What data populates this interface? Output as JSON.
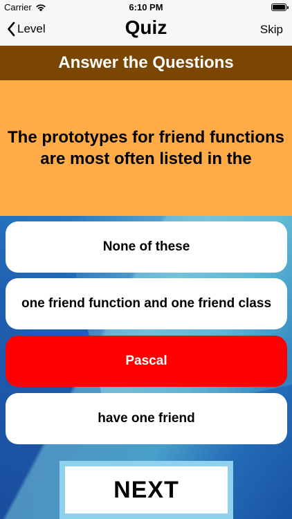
{
  "status_bar": {
    "carrier": "Carrier",
    "time": "6:10 PM"
  },
  "nav": {
    "back_label": "Level",
    "title": "Quiz",
    "skip_label": "Skip"
  },
  "header": {
    "title": "Answer the Questions"
  },
  "question": {
    "text": "The prototypes for friend functions are most often listed in the"
  },
  "answers": [
    {
      "label": "None of these",
      "state": "default"
    },
    {
      "label": "one friend function and one friend class",
      "state": "default"
    },
    {
      "label": "Pascal",
      "state": "selected-wrong"
    },
    {
      "label": "have one friend",
      "state": "default"
    }
  ],
  "next_label": "NEXT",
  "colors": {
    "header_banner": "#7b4503",
    "question_panel": "#ffac48",
    "wrong_answer": "#ff0000",
    "next_frame": "#8fd2f0"
  }
}
